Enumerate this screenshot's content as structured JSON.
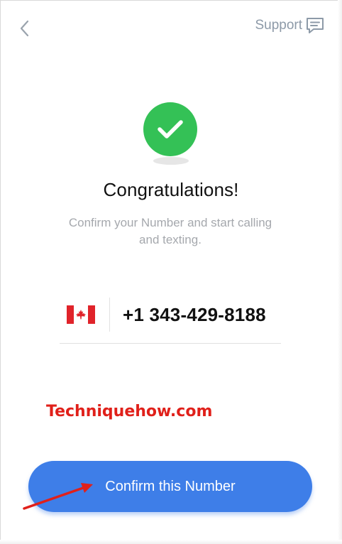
{
  "header": {
    "back_icon": "chevron-left-icon",
    "support_label": "Support",
    "support_icon": "chat-bubble-icon"
  },
  "success": {
    "icon": "checkmark-circle-icon",
    "title": "Congratulations!",
    "subtitle": "Confirm your Number and start calling and texting."
  },
  "phone": {
    "flag_icon": "canada-flag-icon",
    "number": "+1 343-429-8188"
  },
  "watermark": "Techniquehow.com",
  "confirm_label": "Confirm this Number",
  "annotation": "red-arrow-pointer",
  "colors": {
    "accent": "#3e7ee8",
    "success": "#34c156",
    "watermark": "#e0201a",
    "muted_text": "#a5a8ad",
    "support_text": "#8d9aa8"
  }
}
